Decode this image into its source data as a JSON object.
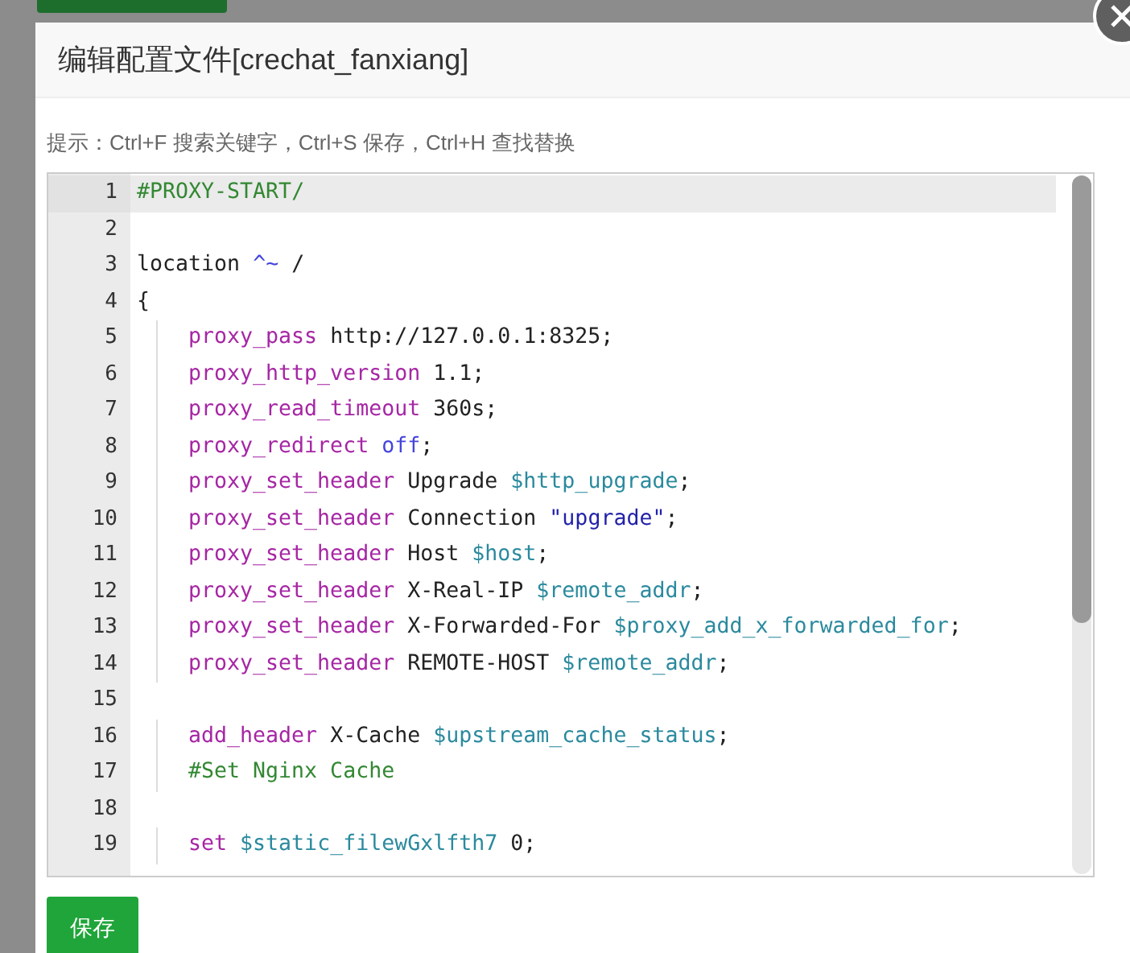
{
  "dialog": {
    "title": "编辑配置文件[crechat_fanxiang]",
    "hint": "提示：Ctrl+F 搜索关键字，Ctrl+S 保存，Ctrl+H 查找替换",
    "editor": {
      "lines": [
        {
          "number": "1",
          "selected": true,
          "tokens": [
            {
              "kind": "comment",
              "text": "#PROXY-START/"
            }
          ]
        },
        {
          "number": "2",
          "selected": false
        },
        {
          "number": "3",
          "selected": false,
          "tokens": [
            {
              "kind": "plain",
              "text": "location "
            },
            {
              "kind": "atom",
              "text": "^~"
            },
            {
              "kind": "plain",
              "text": " /"
            }
          ]
        },
        {
          "number": "4",
          "selected": false,
          "tokens": [
            {
              "kind": "plain",
              "text": "{"
            }
          ]
        },
        {
          "number": "5",
          "selected": false,
          "indent": true,
          "tokens": [
            {
              "kind": "keyword",
              "text": "proxy_pass"
            },
            {
              "kind": "plain",
              "text": " http://127.0.0.1:8325;"
            }
          ]
        },
        {
          "number": "6",
          "selected": false,
          "indent": true,
          "tokens": [
            {
              "kind": "keyword",
              "text": "proxy_http_version"
            },
            {
              "kind": "plain",
              "text": " 1.1;"
            }
          ]
        },
        {
          "number": "7",
          "selected": false,
          "indent": true,
          "tokens": [
            {
              "kind": "keyword",
              "text": "proxy_read_timeout"
            },
            {
              "kind": "plain",
              "text": " 360s;"
            }
          ]
        },
        {
          "number": "8",
          "selected": false,
          "indent": true,
          "tokens": [
            {
              "kind": "keyword",
              "text": "proxy_redirect "
            },
            {
              "kind": "atom",
              "text": "off"
            },
            {
              "kind": "plain",
              "text": ";"
            }
          ]
        },
        {
          "number": "9",
          "selected": false,
          "indent": true,
          "tokens": [
            {
              "kind": "keyword",
              "text": "proxy_set_header"
            },
            {
              "kind": "plain",
              "text": " Upgrade "
            },
            {
              "kind": "variable",
              "text": "$http_upgrade"
            },
            {
              "kind": "plain",
              "text": ";"
            }
          ]
        },
        {
          "number": "10",
          "selected": false,
          "indent": true,
          "tokens": [
            {
              "kind": "keyword",
              "text": "proxy_set_header"
            },
            {
              "kind": "plain",
              "text": " Connection "
            },
            {
              "kind": "string",
              "text": "\"upgrade\""
            },
            {
              "kind": "plain",
              "text": ";"
            }
          ]
        },
        {
          "number": "11",
          "selected": false,
          "indent": true,
          "tokens": [
            {
              "kind": "keyword",
              "text": "proxy_set_header"
            },
            {
              "kind": "plain",
              "text": " Host "
            },
            {
              "kind": "variable",
              "text": "$host"
            },
            {
              "kind": "plain",
              "text": ";"
            }
          ]
        },
        {
          "number": "12",
          "selected": false,
          "indent": true,
          "tokens": [
            {
              "kind": "keyword",
              "text": "proxy_set_header"
            },
            {
              "kind": "plain",
              "text": " X-Real-IP "
            },
            {
              "kind": "variable",
              "text": "$remote_addr"
            },
            {
              "kind": "plain",
              "text": ";"
            }
          ]
        },
        {
          "number": "13",
          "selected": false,
          "indent": true,
          "tokens": [
            {
              "kind": "keyword",
              "text": "proxy_set_header"
            },
            {
              "kind": "plain",
              "text": " X-Forwarded-For "
            },
            {
              "kind": "variable",
              "text": "$proxy_add_x_forwarded_for"
            },
            {
              "kind": "plain",
              "text": ";"
            }
          ]
        },
        {
          "number": "14",
          "selected": false,
          "indent": true,
          "tokens": [
            {
              "kind": "keyword",
              "text": "proxy_set_header"
            },
            {
              "kind": "plain",
              "text": " REMOTE-HOST "
            },
            {
              "kind": "variable",
              "text": "$remote_addr"
            },
            {
              "kind": "plain",
              "text": ";"
            }
          ]
        },
        {
          "number": "15",
          "selected": false
        },
        {
          "number": "16",
          "selected": false,
          "indent": true,
          "tokens": [
            {
              "kind": "keyword",
              "text": "add_header"
            },
            {
              "kind": "plain",
              "text": " X-Cache "
            },
            {
              "kind": "variable",
              "text": "$upstream_cache_status"
            },
            {
              "kind": "plain",
              "text": ";"
            }
          ]
        },
        {
          "number": "17",
          "selected": false,
          "indent": true,
          "tokens": [
            {
              "kind": "comment",
              "text": "#Set Nginx Cache"
            }
          ]
        },
        {
          "number": "18",
          "selected": false
        },
        {
          "number": "19",
          "selected": false,
          "indent": true,
          "tokens": [
            {
              "kind": "keyword",
              "text": "set "
            },
            {
              "kind": "variable",
              "text": "$static_filewGxlfth7"
            },
            {
              "kind": "plain",
              "text": " 0;"
            }
          ]
        }
      ]
    },
    "save_button": "保存"
  }
}
